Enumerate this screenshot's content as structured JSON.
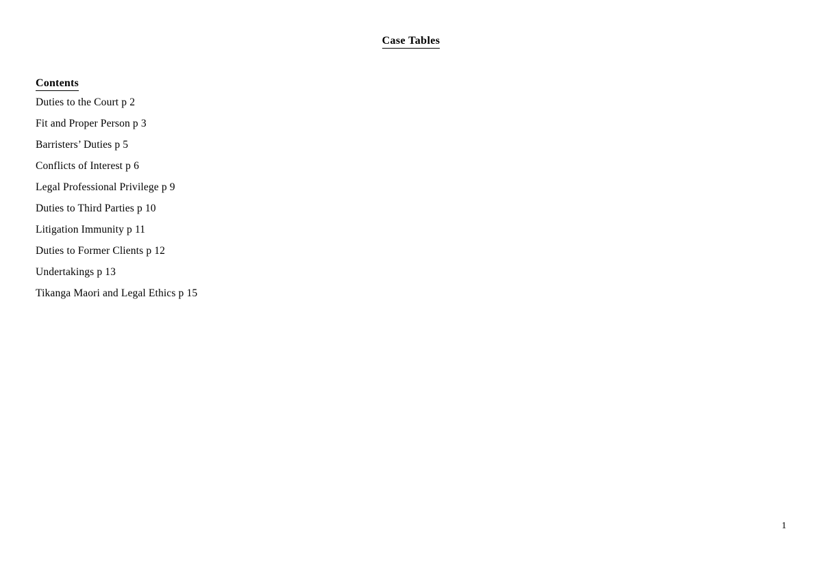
{
  "document": {
    "title": "Case Tables",
    "contents_heading": "Contents",
    "contents_items": [
      "Duties to the Court p 2",
      "Fit and Proper Person p 3",
      "Barristers’ Duties p 5",
      "Conflicts of Interest p 6",
      "Legal Professional Privilege p 9",
      "Duties to Third Parties p 10",
      "Litigation Immunity p 11",
      "Duties to Former Clients p 12",
      "Undertakings p 13",
      "Tikanga Maori and Legal Ethics p 15"
    ],
    "page_number": "1",
    "colors": {
      "page_background": "#ffffff",
      "text": "#000000"
    }
  }
}
